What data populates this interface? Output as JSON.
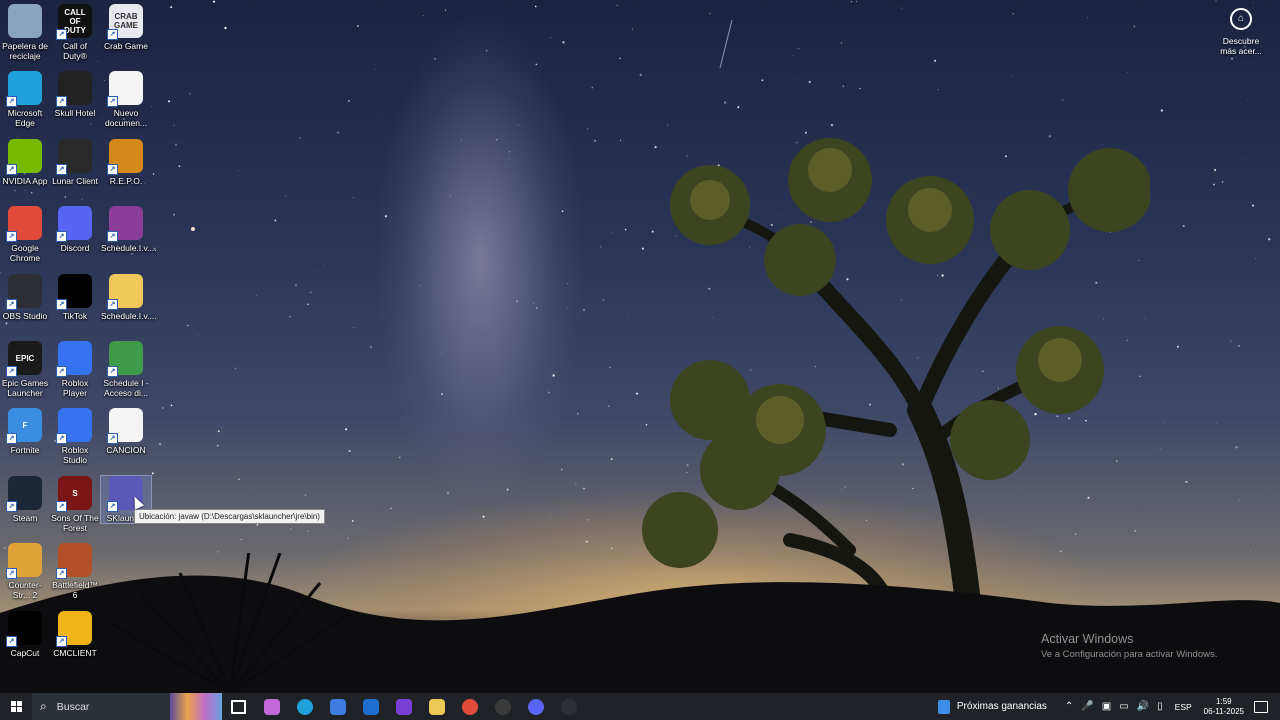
{
  "desktop": {
    "icons": [
      {
        "label": "Papelera de reciclaje",
        "icon": "recycle-bin-icon",
        "color": "#8aa4c0",
        "text": ""
      },
      {
        "label": "Call of Duty®",
        "icon": "call-of-duty-icon",
        "color": "#111111",
        "text": "CALL OF DUTY"
      },
      {
        "label": "Crab Game",
        "icon": "crab-game-icon",
        "color": "#e8e8f0",
        "text": "CRAB GAME"
      },
      {
        "label": "Microsoft Edge",
        "icon": "edge-icon",
        "color": "#1fa0d8",
        "text": ""
      },
      {
        "label": "Skull Hotel",
        "icon": "skull-hotel-icon",
        "color": "#222222",
        "text": ""
      },
      {
        "label": "Nuevo documen...",
        "icon": "document-icon",
        "color": "#f4f4f4",
        "text": ""
      },
      {
        "label": "NVIDIA App",
        "icon": "nvidia-icon",
        "color": "#76b900",
        "text": ""
      },
      {
        "label": "Lunar Client",
        "icon": "lunar-client-icon",
        "color": "#2a2a2a",
        "text": ""
      },
      {
        "label": "R.E.P.O.",
        "icon": "repo-icon",
        "color": "#d48a1a",
        "text": ""
      },
      {
        "label": "Google Chrome",
        "icon": "chrome-icon",
        "color": "#e04b3c",
        "text": ""
      },
      {
        "label": "Discord",
        "icon": "discord-icon",
        "color": "#5865f2",
        "text": ""
      },
      {
        "label": "Schedule.I.v....",
        "icon": "winrar-icon",
        "color": "#8a3e9a",
        "text": ""
      },
      {
        "label": "OBS Studio",
        "icon": "obs-icon",
        "color": "#2e2e36",
        "text": ""
      },
      {
        "label": "TikTok",
        "icon": "tiktok-icon",
        "color": "#000000",
        "text": ""
      },
      {
        "label": "Schedule.I.v....",
        "icon": "folder-icon",
        "color": "#f0c85a",
        "text": ""
      },
      {
        "label": "Epic Games Launcher",
        "icon": "epic-games-icon",
        "color": "#1a1a1a",
        "text": "EPIC"
      },
      {
        "label": "Roblox Player",
        "icon": "roblox-player-icon",
        "color": "#3573f0",
        "text": ""
      },
      {
        "label": "Schedule I - Acceso di...",
        "icon": "schedule-i-icon",
        "color": "#3f9a4a",
        "text": ""
      },
      {
        "label": "Fortnite",
        "icon": "fortnite-icon",
        "color": "#3a8de0",
        "text": "F"
      },
      {
        "label": "Roblox Studio",
        "icon": "roblox-studio-icon",
        "color": "#3573f0",
        "text": ""
      },
      {
        "label": "CANCION",
        "icon": "document-icon",
        "color": "#f4f4f4",
        "text": ""
      },
      {
        "label": "Steam",
        "icon": "steam-icon",
        "color": "#1b2838",
        "text": ""
      },
      {
        "label": "Sons Of The Forest",
        "icon": "sons-of-the-forest-icon",
        "color": "#7a1515",
        "text": "S"
      },
      {
        "label": "SKlaunc...",
        "icon": "sklauncher-icon",
        "color": "#5b58b8",
        "text": ""
      },
      {
        "label": "Counter-Str... 2",
        "icon": "counter-strike-icon",
        "color": "#e2a23a",
        "text": ""
      },
      {
        "label": "Battlefield™ 6",
        "icon": "battlefield-icon",
        "color": "#b2502a",
        "text": ""
      },
      {
        "label": "CapCut",
        "icon": "capcut-icon",
        "color": "#000000",
        "text": ""
      },
      {
        "label": "CMCLIENT",
        "icon": "cmclient-icon",
        "color": "#f0b418",
        "text": ""
      }
    ],
    "tooltip": "Ubicación: javaw (D:\\Descargas\\sklauncher\\jre\\bin)",
    "discover": "Descubre más acer...",
    "activate_title": "Activar Windows",
    "activate_sub": "Ve a Configuración para activar Windows."
  },
  "taskbar": {
    "search_placeholder": "Buscar",
    "apps": [
      {
        "name": "task-view",
        "color": "#ffffff"
      },
      {
        "name": "copilot",
        "color": "#c368d8"
      },
      {
        "name": "edge",
        "color": "#1fa0d8"
      },
      {
        "name": "microsoft-store",
        "color": "#3f7de0"
      },
      {
        "name": "outlook",
        "color": "#1f6fd0"
      },
      {
        "name": "clipchamp",
        "color": "#7a3fd6"
      },
      {
        "name": "file-explorer",
        "color": "#f0c85a"
      },
      {
        "name": "chrome",
        "color": "#e04b3c"
      },
      {
        "name": "lunar-client",
        "color": "#3a3a3a"
      },
      {
        "name": "discord",
        "color": "#5865f2"
      },
      {
        "name": "obs-studio",
        "color": "#2e2e36"
      }
    ],
    "news": "Próximas ganancias",
    "language": "ESP",
    "time": "1:59",
    "date": "06-11-2025"
  }
}
